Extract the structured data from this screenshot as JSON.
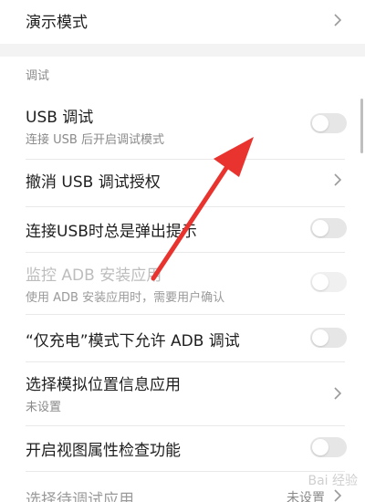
{
  "colors": {
    "accent": "#e8332e",
    "toggle_off": "#e6e6e6",
    "divider": "#e9e9e9"
  },
  "top_item": {
    "title": "演示模式",
    "icon": "chevron-right-icon"
  },
  "section_header": "调试",
  "items": [
    {
      "title": "USB 调试",
      "subtitle": "连接 USB 后开启调试模式",
      "control": "toggle",
      "state": "off"
    },
    {
      "title": "撤消 USB 调试授权",
      "control": "chevron"
    },
    {
      "title": "连接USB时总是弹出提示",
      "control": "toggle",
      "state": "off"
    },
    {
      "title": "监控 ADB 安装应用",
      "subtitle": "使用 ADB 安装应用时，需要用户确认",
      "control": "toggle",
      "state": "off",
      "disabled": true
    },
    {
      "title": "“仅充电”模式下允许 ADB 调试",
      "control": "toggle",
      "state": "off"
    },
    {
      "title": "选择模拟位置信息应用",
      "subtitle": "未设置",
      "control": "chevron"
    },
    {
      "title": "开启视图属性检查功能",
      "control": "toggle",
      "state": "off"
    },
    {
      "title": "选择待调试应用",
      "value": "未设置",
      "control": "chevron"
    }
  ],
  "watermark": "Bai 经验"
}
